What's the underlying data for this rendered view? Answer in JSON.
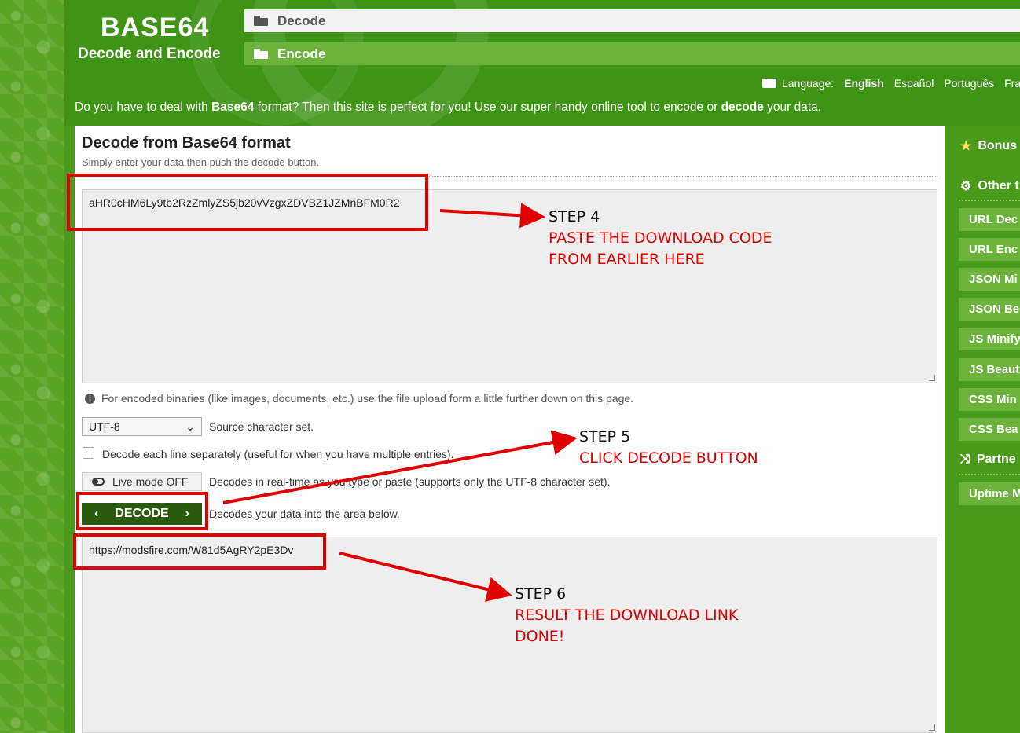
{
  "header": {
    "logo_title": "BASE64",
    "logo_subtitle": "Decode and Encode",
    "nav": [
      {
        "label": "Decode"
      },
      {
        "label": "Encode"
      }
    ],
    "language_label": "Language:",
    "languages": [
      "English",
      "Español",
      "Português",
      "Fran"
    ],
    "intro": {
      "part1": "Do you have to deal with ",
      "bold1": "Base64",
      "part2": " format? Then this site is perfect for you! Use our super handy online tool to encode or ",
      "bold2": "decode",
      "part3": " your data."
    }
  },
  "main": {
    "title": "Decode from Base64 format",
    "subtitle": "Simply enter your data then push the decode button.",
    "input_value": "aHR0cHM6Ly9tb2RzZmlyZS5jb20vVzgxZDVBZ1JZMnBFM0R2",
    "info": "For encoded binaries (like images, documents, etc.) use the file upload form a little further down on this page.",
    "charset_value": "UTF-8",
    "charset_label": "Source character set.",
    "decode_lines_label": "Decode each line separately (useful for when you have multiple entries).",
    "live_mode_label": "Live mode OFF",
    "live_mode_desc": "Decodes in real-time as you type or paste (supports only the UTF-8 character set).",
    "decode_button": "DECODE",
    "decode_desc": "Decodes your data into the area below.",
    "output_value": "https://modsfire.com/W81d5AgRY2pE3Dv"
  },
  "sidebar": {
    "bonus": "Bonus",
    "other": "Other t",
    "items": [
      "URL Dec",
      "URL Enc",
      "JSON Mi",
      "JSON Be",
      "JS Minify",
      "JS Beaut",
      "CSS Min",
      "CSS Bea"
    ],
    "partners": "Partne",
    "uptime": "Uptime M"
  },
  "annotations": {
    "step4": {
      "step": "STEP 4",
      "line1": "PASTE THE DOWNLOAD CODE",
      "line2": "FROM EARLIER HERE"
    },
    "step5": {
      "step": "STEP 5",
      "line1": "CLICK DECODE BUTTON"
    },
    "step6": {
      "step": "STEP 6",
      "line1": "RESULT THE DOWNLOAD LINK",
      "line2": "DONE!"
    }
  },
  "colors": {
    "brand_green": "#3f9416",
    "annotation_red": "#e00000",
    "decode_button": "#2b5a0f"
  }
}
